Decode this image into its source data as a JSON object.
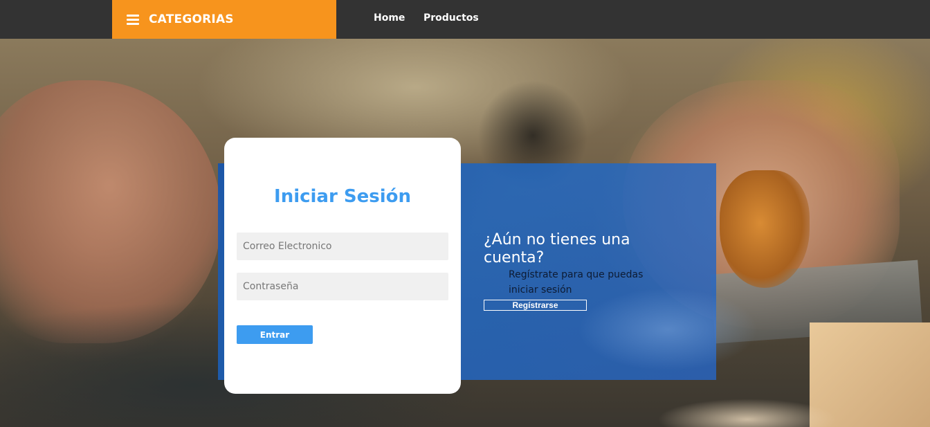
{
  "navbar": {
    "categories_label": "CATEGORIAS",
    "links": [
      {
        "label": "Home"
      },
      {
        "label": "Productos"
      }
    ]
  },
  "login": {
    "title": "Iniciar Sesión",
    "email_placeholder": "Correo Electronico",
    "password_placeholder": "Contraseña",
    "submit_label": "Entrar"
  },
  "register": {
    "title": "¿Aún no tienes una cuenta?",
    "text": "Regístrate para que puedas iniciar sesión",
    "button_label": "Regístrarse"
  },
  "colors": {
    "accent_orange": "#f7941d",
    "accent_blue": "#3d9cf0",
    "navbar_bg": "#333333"
  }
}
